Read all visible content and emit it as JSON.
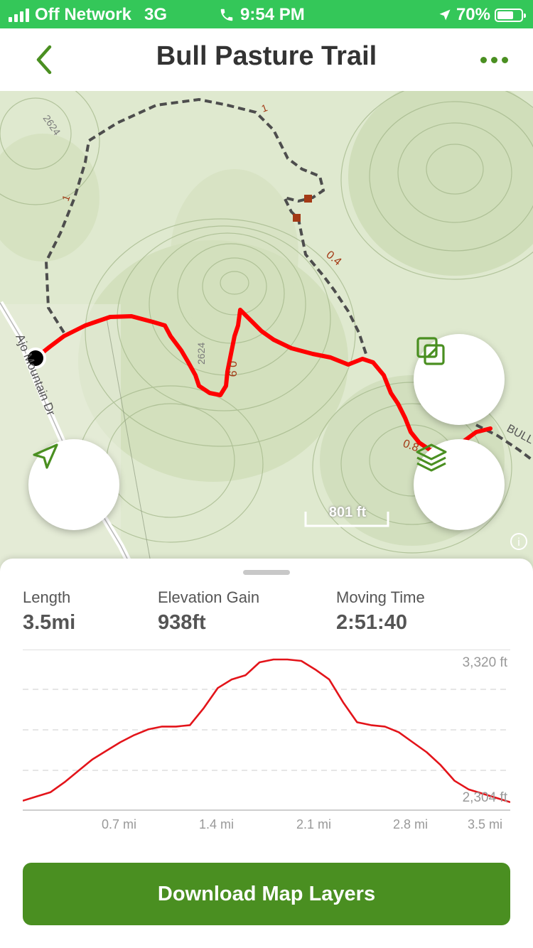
{
  "status": {
    "carrier": "Off Network",
    "network": "3G",
    "time": "9:54 PM",
    "battery": "70%",
    "battery_level": 0.7
  },
  "nav": {
    "title": "Bull Pasture Trail",
    "back_icon": "chevron-left-icon",
    "more_icon": "more-dots-icon"
  },
  "map": {
    "labels": {
      "elev_top": "2624",
      "elev_mid": "2624",
      "mile_1_left": "1",
      "mile_1_top": "1",
      "mile_04": "0.4",
      "mile_09": "0.9",
      "mile_08": "0.8",
      "road": "Ajo Mountain Dr",
      "trail": "BULL"
    },
    "scale_label": "801 ft",
    "buttons": {
      "locate_icon": "navigation-arrow-icon",
      "overlay_icon": "overlay-squares-icon",
      "layers_icon": "layers-icon",
      "info_icon": "info-icon"
    },
    "colors": {
      "route": "#ff0000",
      "accent": "#4a8f21"
    }
  },
  "stats": {
    "length_label": "Length",
    "length_value": "3.5mi",
    "elev_label": "Elevation Gain",
    "elev_value": "938ft",
    "time_label": "Moving Time",
    "time_value": "2:51:40"
  },
  "elevation_profile": {
    "y_max_label": "3,320 ft",
    "y_min_label": "2,304 ft",
    "x_ticks": [
      "0.7 mi",
      "1.4 mi",
      "2.1 mi",
      "2.8 mi",
      "3.5 mi"
    ]
  },
  "chart_data": {
    "type": "line",
    "title": "",
    "xlabel": "",
    "ylabel": "",
    "x_unit": "mi",
    "y_unit": "ft",
    "xlim": [
      0,
      3.5
    ],
    "ylim": [
      2304,
      3320
    ],
    "x_ticks": [
      "0.7 mi",
      "1.4 mi",
      "2.1 mi",
      "2.8 mi",
      "3.5 mi"
    ],
    "series": [
      {
        "x": [
          0,
          0.1,
          0.2,
          0.3,
          0.4,
          0.5,
          0.6,
          0.7,
          0.8,
          0.9,
          1.0,
          1.1,
          1.2,
          1.3,
          1.4,
          1.5,
          1.6,
          1.7,
          1.8,
          1.9,
          2.0,
          2.1,
          2.2,
          2.3,
          2.4,
          2.5,
          2.6,
          2.7,
          2.8,
          2.9,
          3.0,
          3.1,
          3.2,
          3.3,
          3.4,
          3.5
        ],
        "y": [
          2330,
          2360,
          2390,
          2460,
          2540,
          2620,
          2680,
          2740,
          2790,
          2830,
          2850,
          2850,
          2860,
          2980,
          3120,
          3180,
          3210,
          3300,
          3320,
          3320,
          3310,
          3250,
          3180,
          3020,
          2880,
          2860,
          2850,
          2810,
          2740,
          2670,
          2580,
          2470,
          2410,
          2380,
          2350,
          2320
        ]
      }
    ],
    "grid": true
  }
}
